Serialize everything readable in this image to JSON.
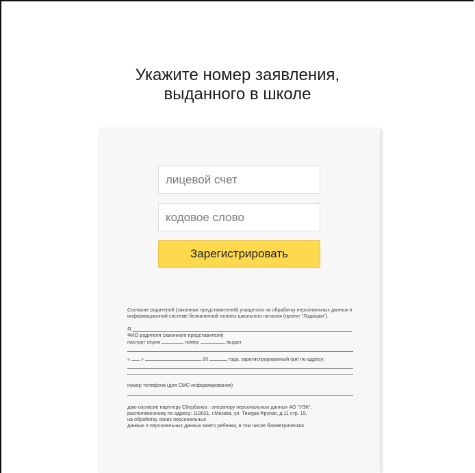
{
  "page": {
    "title_line1": "Укажите номер заявления,",
    "title_line2": "выданного в школе"
  },
  "form": {
    "account_placeholder": "лицевой счет",
    "code_placeholder": "кодовое слово",
    "submit_label": "Зарегистрировать"
  },
  "consent": {
    "heading": "Согласие родителей (законных представителей) учащегося на обработку персональных данных в информационной системе безналичной оплаты школьного питания (проект \"Ладошки\").",
    "i_label": "Я,",
    "fio_label": "ФИО родителя (законного представителя)",
    "passport_series": "паспорт серии",
    "passport_number": "номер",
    "passport_issued": "выдан",
    "date_open": "«",
    "date_close": "»",
    "year_prefix": "20",
    "year_suffix": "года, зарегистрированный (ая) по адресу:",
    "phone_label": "номер телефона (для СМС-информирования)",
    "agreement_line1": "даю согласие партнеру Сбербанка - оператору персональных данных АО \"УЭК\",",
    "agreement_line2": "расположенному по адресу: 119021, г.Москва, ул. Тимура Фрунзе, д.11 стр. 15,",
    "agreement_line3": "на обработку своих персональных",
    "agreement_line4": "данных и персональных данных моего ребенка, в том числе биометрических"
  },
  "colors": {
    "button": "#fed84d",
    "card_background": "#f7f7f7"
  }
}
